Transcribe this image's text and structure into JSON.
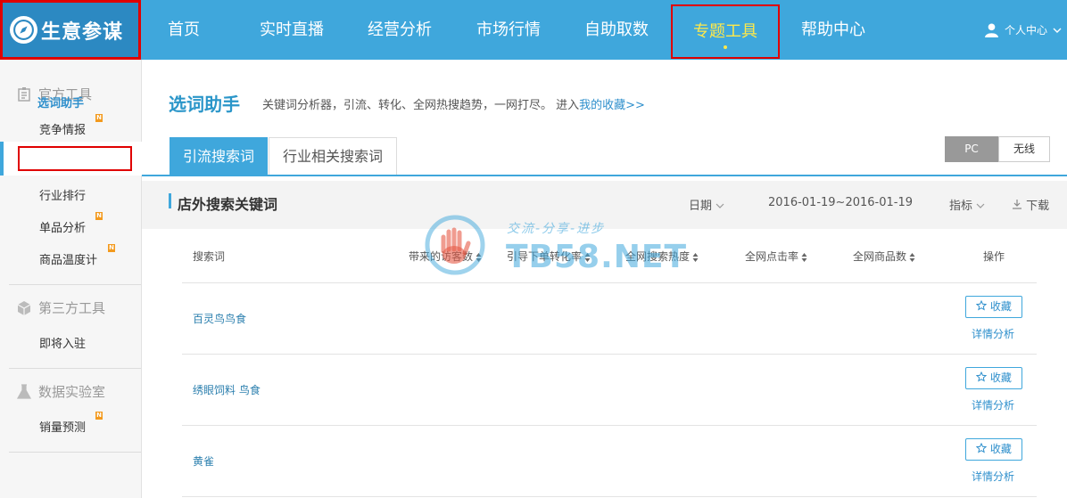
{
  "brand": {
    "name": "生意参谋"
  },
  "nav": {
    "items": [
      "首页",
      "实时直播",
      "经营分析",
      "市场行情",
      "自助取数",
      "专题工具",
      "帮助中心"
    ],
    "active": "专题工具",
    "user": "个人中心"
  },
  "sidebar": {
    "sections": [
      {
        "title": "官方工具",
        "items": [
          "竞争情报",
          "选词助手",
          "行业排行",
          "单品分析",
          "商品温度计"
        ]
      },
      {
        "title": "第三方工具",
        "items": [
          "即将入驻"
        ]
      },
      {
        "title": "数据实验室",
        "items": [
          "销量预测"
        ]
      }
    ],
    "badge": "N"
  },
  "main": {
    "title": "选词助手",
    "description": "关键词分析器，引流、转化、全网热搜趋势，一网打尽。 进入",
    "fav_link": "我的收藏>>",
    "tabs": [
      "引流搜索词",
      "行业相关搜索词"
    ],
    "device_toggle": [
      "PC",
      "无线"
    ],
    "section_title": "店外搜索关键词",
    "date_label": "日期",
    "date_range": "2016-01-19~2016-01-19",
    "metric_label": "指标",
    "download_label": "下载"
  },
  "table": {
    "columns": [
      "搜索词",
      "带来的访客数",
      "引导下单转化率",
      "全网搜索热度",
      "全网点击率",
      "全网商品数",
      "操作"
    ],
    "rows": [
      {
        "keyword": "百灵鸟鸟食",
        "action": "收藏",
        "detail": "详情分析"
      },
      {
        "keyword": "绣眼饲料 鸟食",
        "action": "收藏",
        "detail": "详情分析"
      },
      {
        "keyword": "黄雀",
        "action": "收藏",
        "detail": "详情分析"
      }
    ]
  },
  "watermark": {
    "text": "TB58.NET",
    "tagline": "交流-分享-进步"
  },
  "colors": {
    "primary": "#3fa7dc",
    "highlight": "#e00000",
    "active_nav_text": "#ffe94a",
    "badge": "#f39a1e"
  },
  "icons": [
    "compass-icon",
    "user-icon",
    "chevron-down-icon",
    "tools-icon",
    "cube-icon",
    "flask-icon",
    "star-icon",
    "download-icon",
    "sort-icon"
  ]
}
